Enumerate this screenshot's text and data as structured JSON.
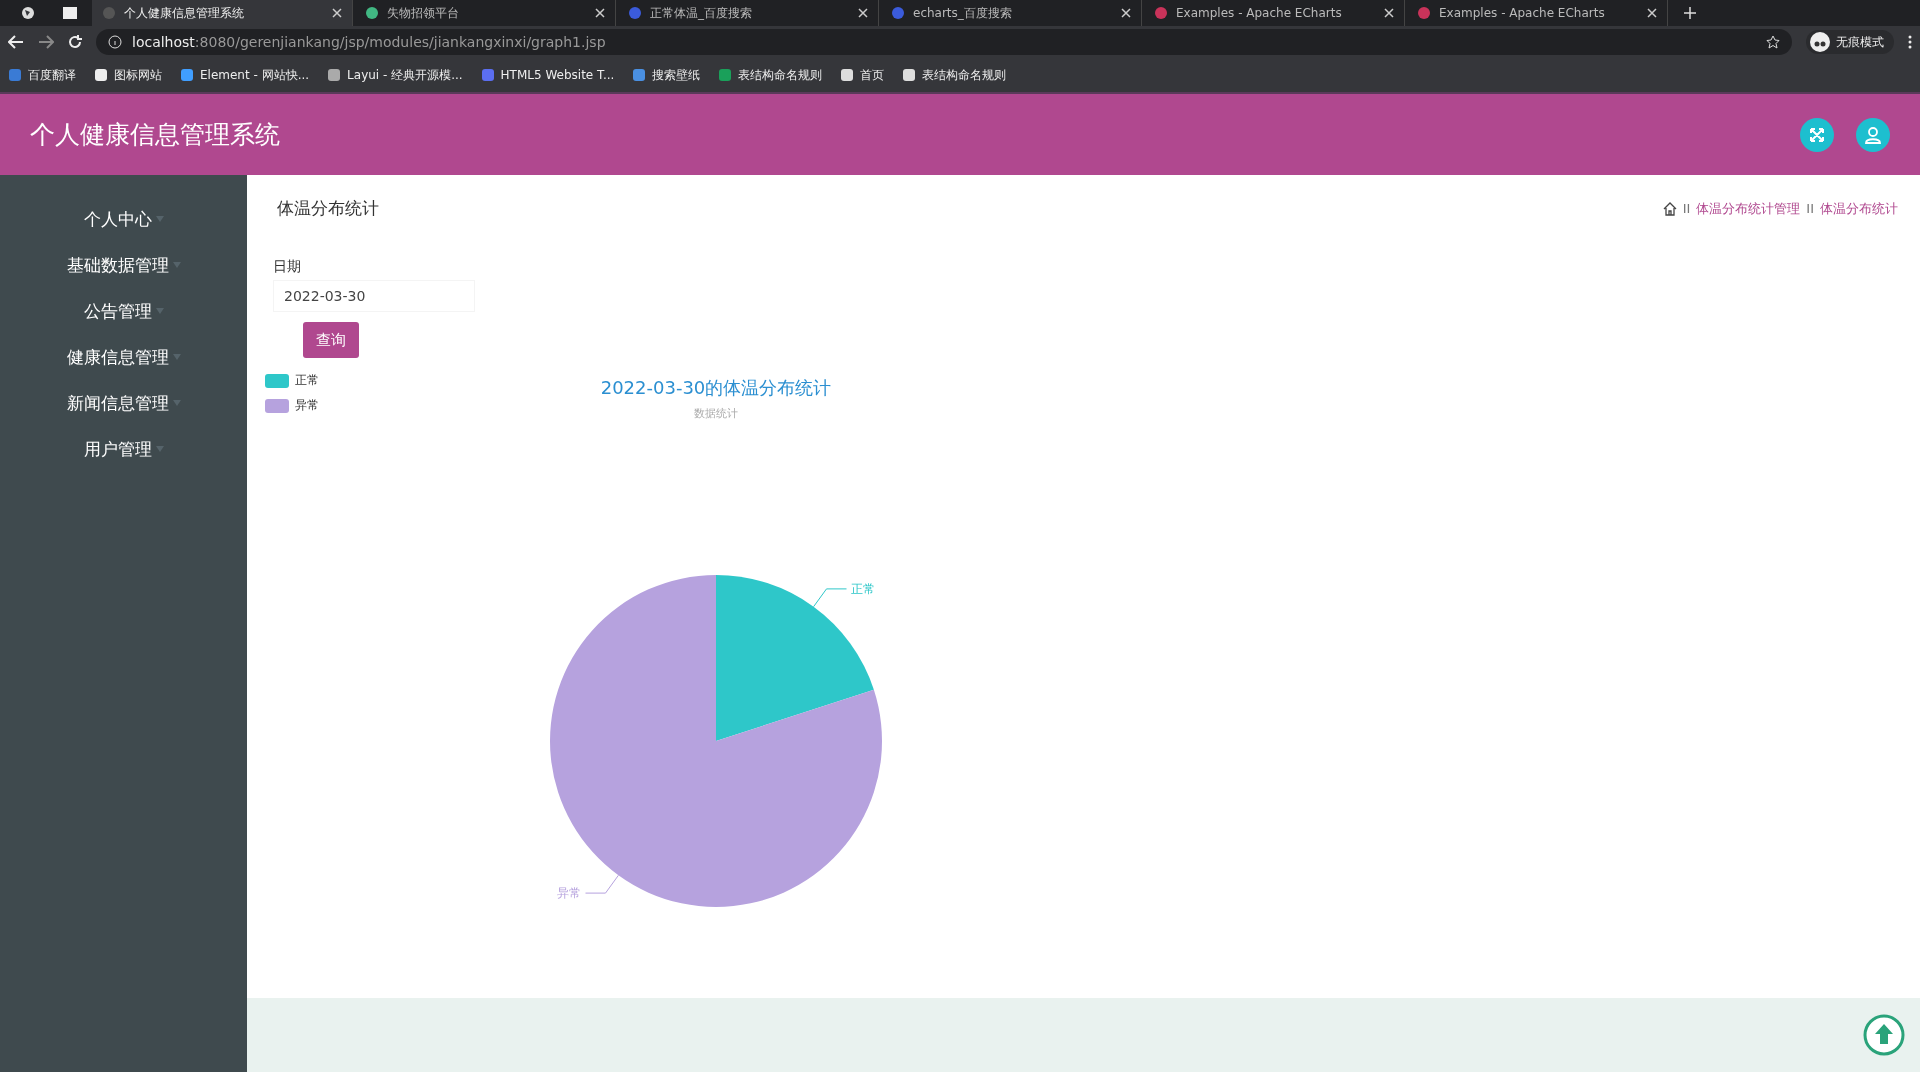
{
  "browser": {
    "tabs": [
      {
        "title": "个人健康信息管理系统",
        "selected": true
      },
      {
        "title": "失物招领平台",
        "selected": false
      },
      {
        "title": "正常体温_百度搜索",
        "selected": false
      },
      {
        "title": "echarts_百度搜索",
        "selected": false
      },
      {
        "title": "Examples - Apache ECharts",
        "selected": false
      },
      {
        "title": "Examples - Apache ECharts",
        "selected": false
      }
    ],
    "address": {
      "host": "localhost",
      "rest": ":8080/gerenjiankang/jsp/modules/jiankangxinxi/graph1.jsp"
    },
    "profile": "无痕模式",
    "bookmarks": [
      "百度翻译",
      "图标网站",
      "Element - 网站快...",
      "Layui - 经典开源模...",
      "HTML5 Website T...",
      "搜索壁纸",
      "表结构命名规则",
      "首页",
      "表结构命名规则"
    ]
  },
  "app": {
    "title": "个人健康信息管理系统"
  },
  "sidebar": {
    "items": [
      "个人中心",
      "基础数据管理",
      "公告管理",
      "健康信息管理",
      "新闻信息管理",
      "用户管理"
    ]
  },
  "page": {
    "title": "体温分布统计",
    "breadcrumb": [
      {
        "separator": "II",
        "label": "体温分布统计管理"
      },
      {
        "separator": "II",
        "label": "体温分布统计"
      }
    ],
    "filter": {
      "label": "日期",
      "value": "2022-03-30",
      "button": "查询"
    },
    "chart_data": {
      "type": "pie",
      "title": "2022-03-30的体温分布统计",
      "subtitle": "数据统计",
      "categories": [
        "正常",
        "异常"
      ],
      "values": [
        20,
        80
      ],
      "colors": [
        "#2ec7c9",
        "#b6a2de"
      ],
      "legend": true
    }
  }
}
